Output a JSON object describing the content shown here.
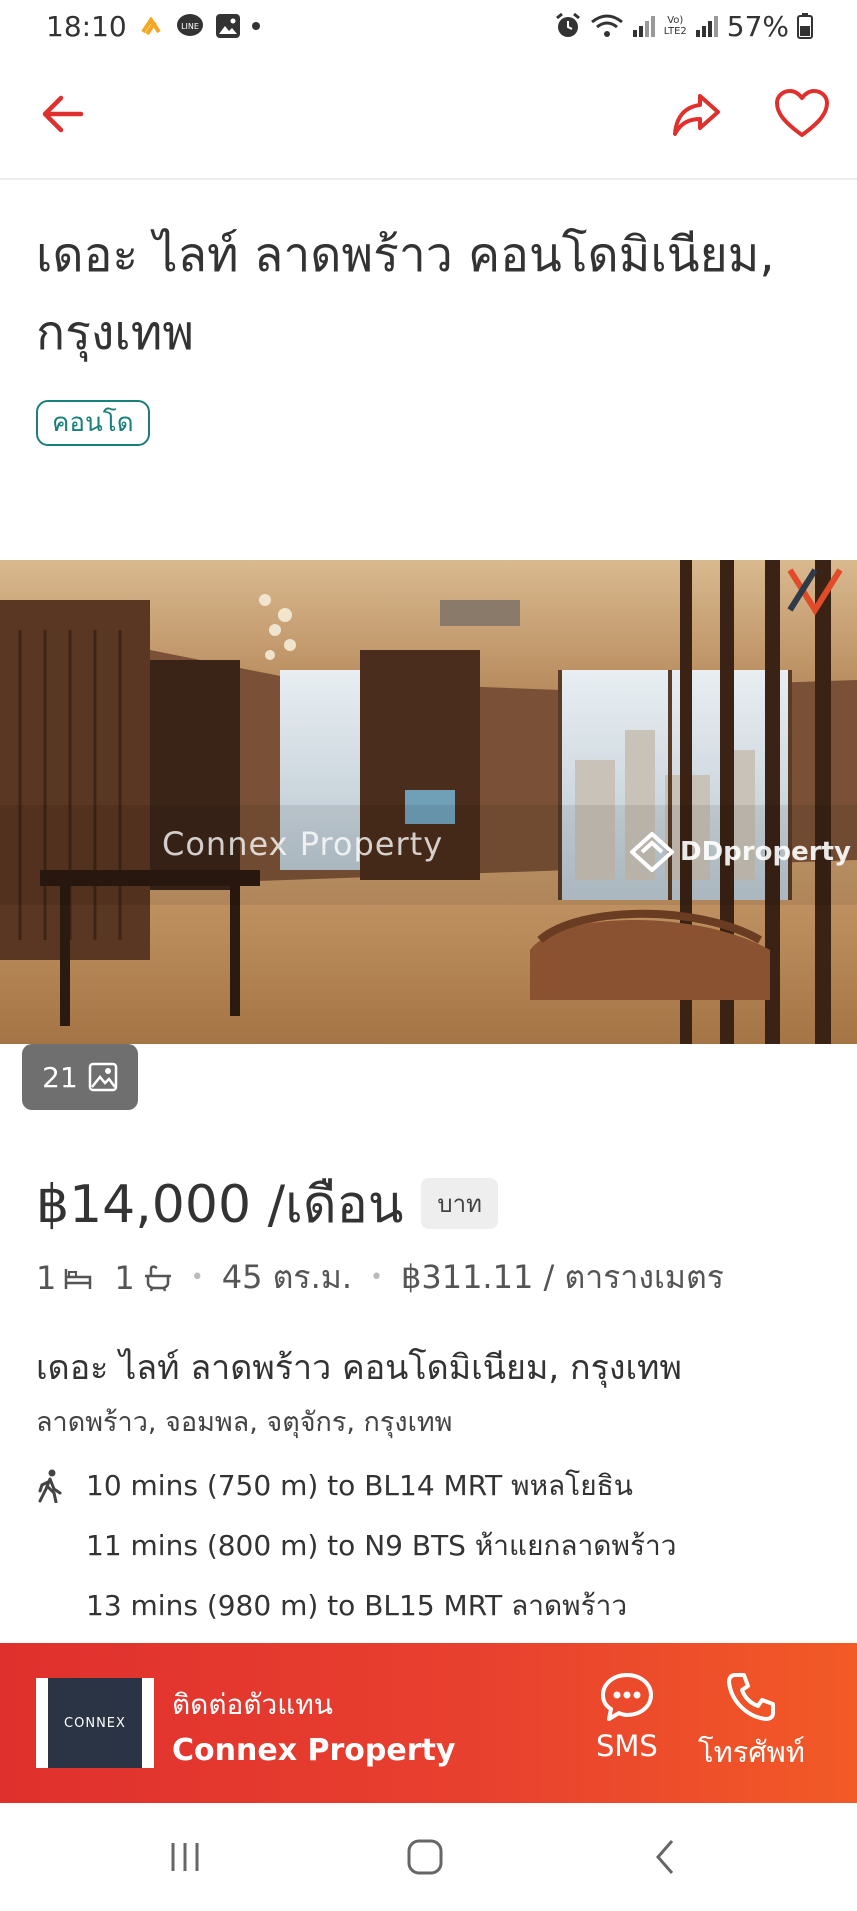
{
  "status": {
    "time": "18:10",
    "battery": "57%",
    "network": "LTE2",
    "volte": "Vo)"
  },
  "header": {
    "back_icon": "arrow-left-icon",
    "share_icon": "share-icon",
    "favorite_icon": "heart-icon"
  },
  "listing": {
    "title": "เดอะ ไลท์ ลาดพร้าว คอนโดมิเนียม, กรุงเทพ",
    "type": "คอนโด",
    "photo_count": "21",
    "watermarks": {
      "agency": "Connex Property",
      "portal": "DDproperty"
    },
    "price": "฿14,000 /เดือน",
    "currency": "บาท",
    "specs": {
      "bedrooms": "1",
      "bathrooms": "1",
      "area": "45 ตร.ม.",
      "price_per_area": "฿311.11 / ตารางเมตร"
    },
    "project_name": "เดอะ ไลท์ ลาดพร้าว คอนโดมิเนียม, กรุงเทพ",
    "location": "ลาดพร้าว, จอมพล, จตุจักร, กรุงเทพ",
    "transit": [
      "10 mins (750 m) to BL14 MRT พหลโยธิน",
      "11 mins (800 m) to N9 BTS ห้าแยกลาดพร้าว",
      "13 mins (980 m) to BL15 MRT ลาดพร้าว"
    ]
  },
  "contact": {
    "label": "ติดต่อตัวแทน",
    "agent_name": "Connex Property",
    "logo_text": "CONNEX",
    "sms_label": "SMS",
    "call_label": "โทรศัพท์"
  },
  "colors": {
    "accent": "#e0302d",
    "accent_end": "#f25a26",
    "badge": "#1a7f7a"
  }
}
